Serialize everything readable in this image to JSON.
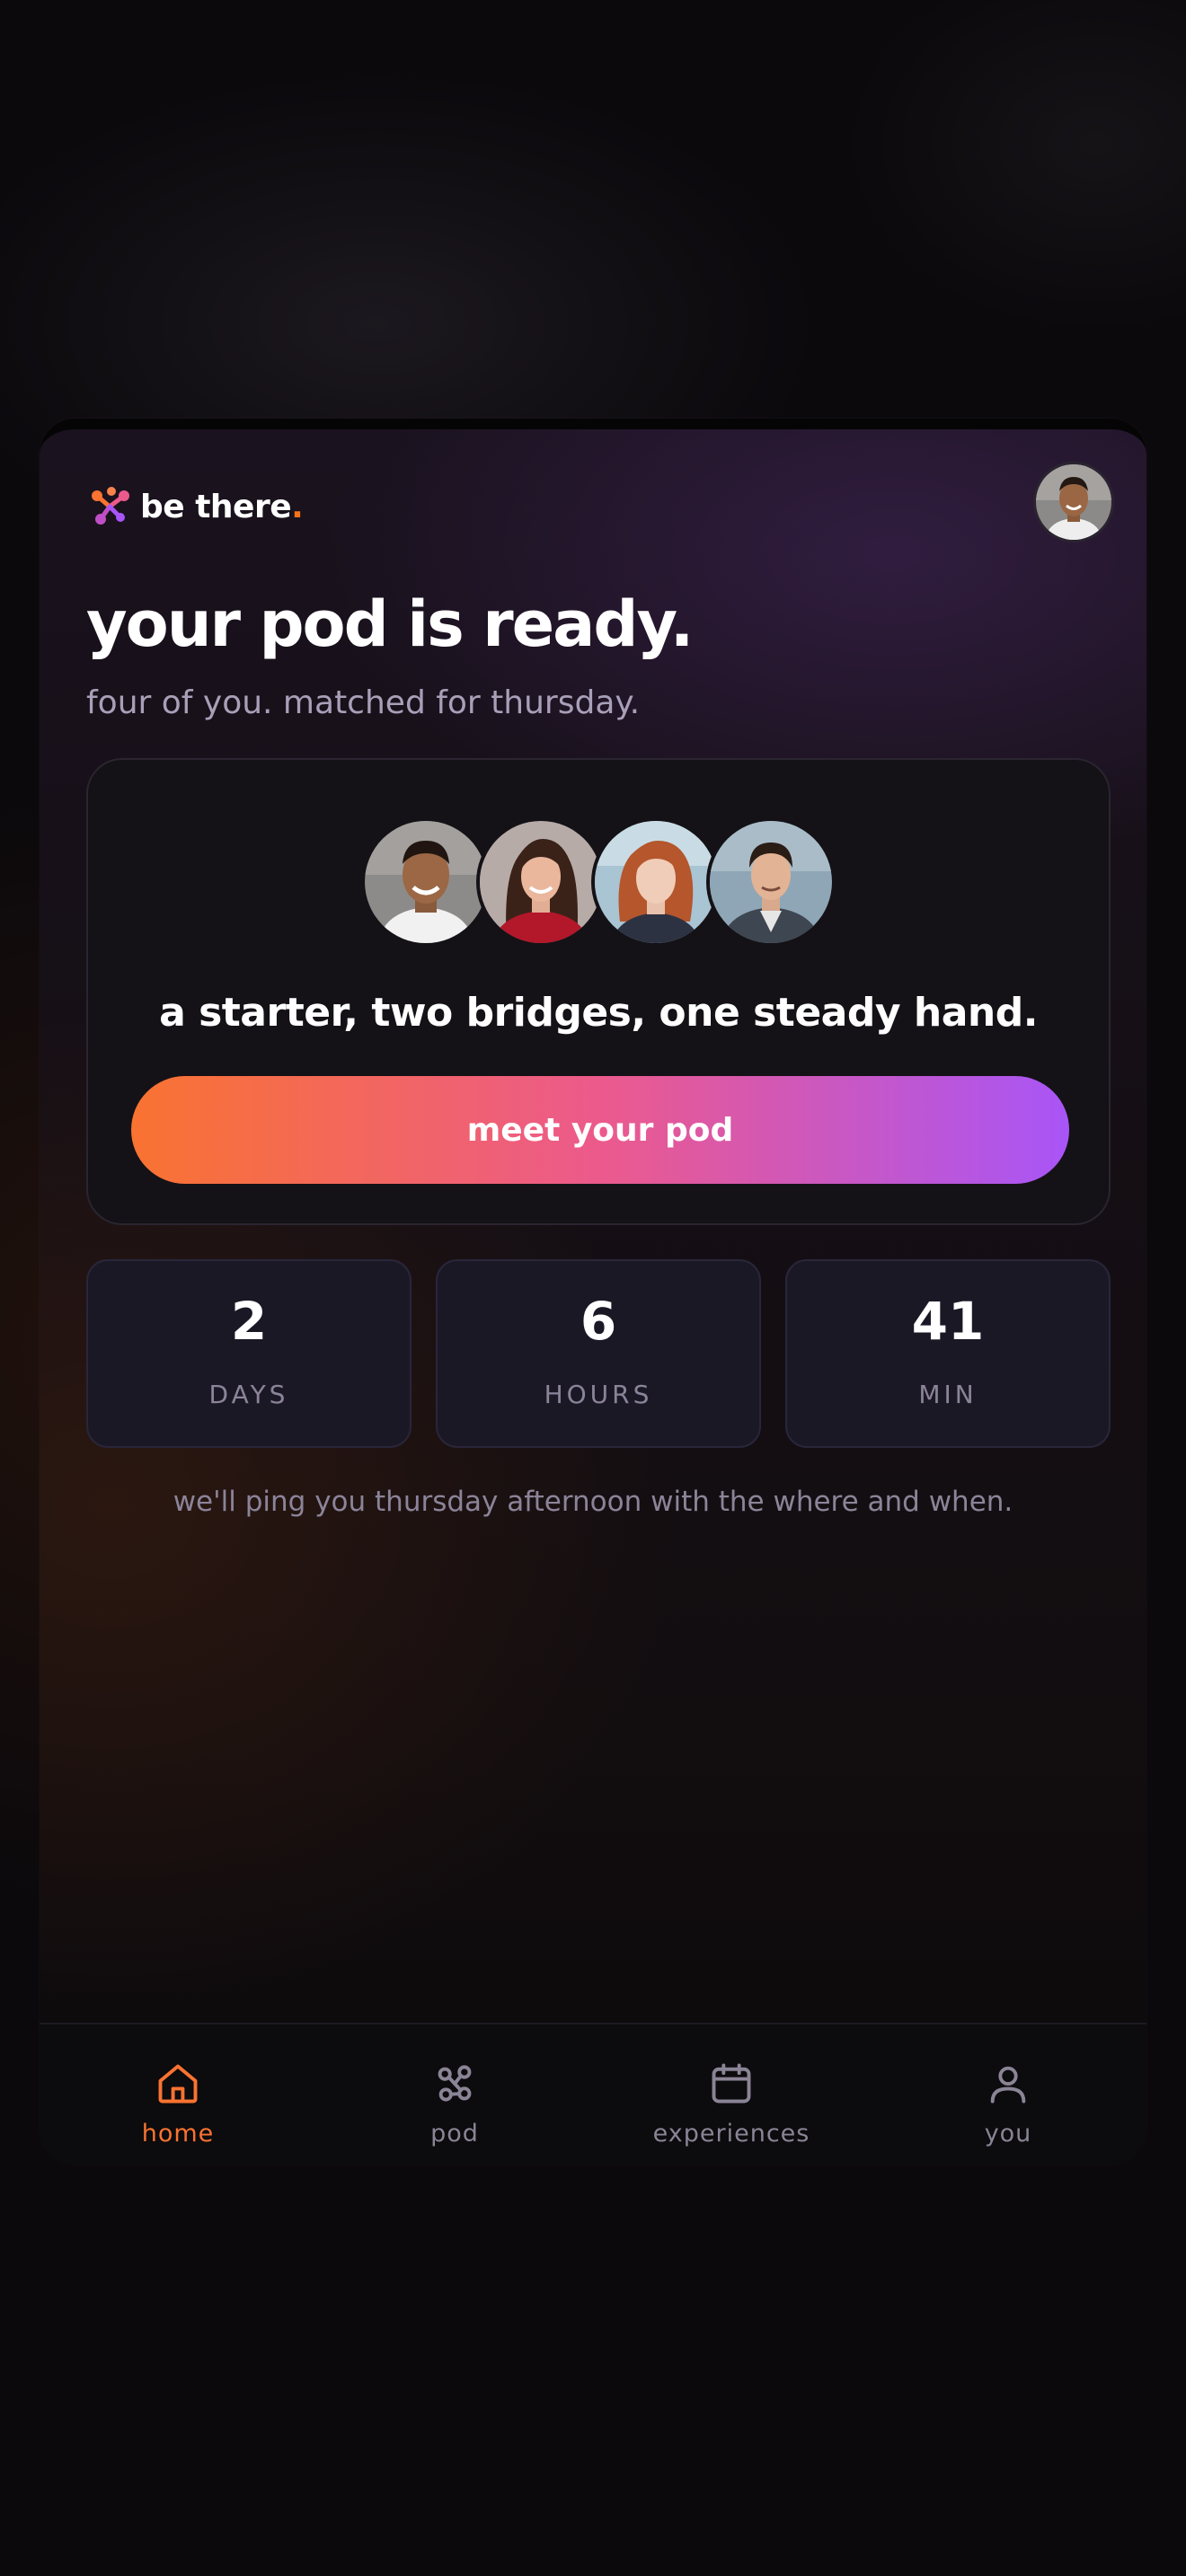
{
  "app": {
    "brand_name": "be there",
    "brand_dot": "."
  },
  "colors": {
    "accent_orange": "#f97331",
    "accent_pink": "#ec5a8c",
    "accent_purple": "#a855f7",
    "background": "#0b090c"
  },
  "header": {
    "title": "your pod is ready.",
    "subtitle": "four of you. matched for thursday."
  },
  "pod_card": {
    "members": [
      {
        "icon": "avatar-man-smiling"
      },
      {
        "icon": "avatar-woman-red-top"
      },
      {
        "icon": "avatar-woman-auburn-hair"
      },
      {
        "icon": "avatar-man-suit"
      }
    ],
    "roles_line": "a starter, two bridges, one steady hand.",
    "cta_label": "meet your pod"
  },
  "countdown": [
    {
      "value": "2",
      "unit": "DAYS"
    },
    {
      "value": "6",
      "unit": "HOURS"
    },
    {
      "value": "41",
      "unit": "MIN"
    }
  ],
  "note": "we'll ping you thursday afternoon with the where and when.",
  "tabs": [
    {
      "label": "home",
      "icon": "home-icon",
      "active": true
    },
    {
      "label": "pod",
      "icon": "pod-icon",
      "active": false
    },
    {
      "label": "experiences",
      "icon": "calendar-icon",
      "active": false
    },
    {
      "label": "you",
      "icon": "user-icon",
      "active": false
    }
  ]
}
